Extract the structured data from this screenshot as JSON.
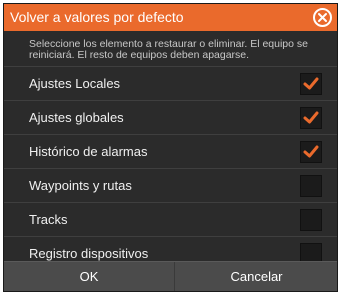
{
  "dialog": {
    "title": "Volver a valores por defecto",
    "instructions": "Seleccione los elemento a restaurar o eliminar. El equipo se reiniciará. El resto de equipos deben apagarse.",
    "items": [
      {
        "label": "Ajustes Locales",
        "checked": true
      },
      {
        "label": "Ajustes globales",
        "checked": true
      },
      {
        "label": "Histórico de alarmas",
        "checked": true
      },
      {
        "label": "Waypoints y rutas",
        "checked": false
      },
      {
        "label": "Tracks",
        "checked": false
      },
      {
        "label": "Registro dispositivos",
        "checked": false
      }
    ],
    "buttons": {
      "ok": "OK",
      "cancel": "Cancelar"
    }
  },
  "icons": {
    "close": "close-circle-icon",
    "checked": "checkmark-icon"
  },
  "colors": {
    "accent": "#ea6a2c",
    "dialog_background": "#2b2b2b",
    "footer_background": "#4b4b4b",
    "checkbox_background": "#1b1b1b"
  }
}
